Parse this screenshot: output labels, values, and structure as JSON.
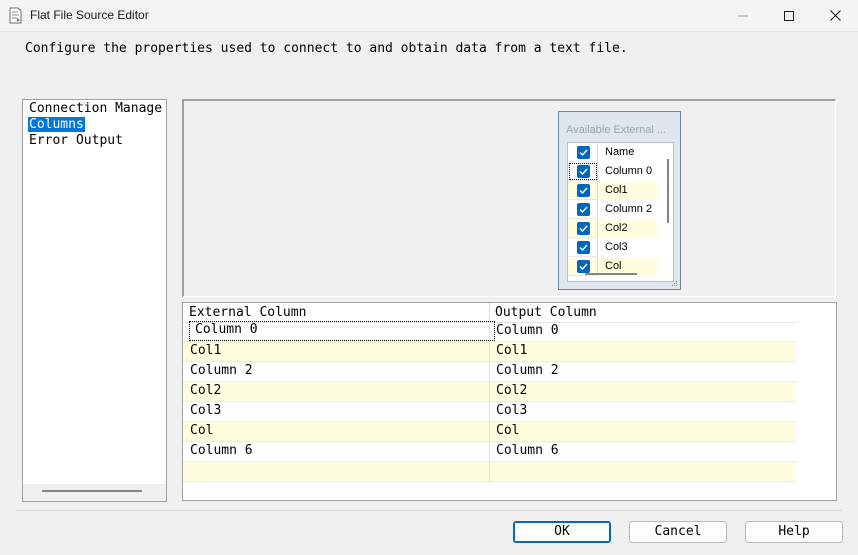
{
  "window": {
    "title": "Flat File Source Editor"
  },
  "description": "Configure the properties used to connect to and obtain data from a text file.",
  "nav": {
    "items": [
      {
        "label": "Connection Manage",
        "selected": false
      },
      {
        "label": "Columns",
        "selected": true
      },
      {
        "label": "Error Output",
        "selected": false
      }
    ]
  },
  "external_columns": {
    "title": "Available External ...",
    "items": [
      {
        "label": "Name",
        "checked": true
      },
      {
        "label": "Column 0",
        "checked": true
      },
      {
        "label": "Col1",
        "checked": true
      },
      {
        "label": "Column 2",
        "checked": true
      },
      {
        "label": "Col2",
        "checked": true
      },
      {
        "label": "Col3",
        "checked": true
      },
      {
        "label": "Col",
        "checked": true
      }
    ]
  },
  "grid": {
    "headers": [
      "External Column",
      "Output Column"
    ],
    "rows": [
      [
        "Column 0",
        "Column 0"
      ],
      [
        "Col1",
        "Col1"
      ],
      [
        "Column 2",
        "Column 2"
      ],
      [
        "Col2",
        "Col2"
      ],
      [
        "Col3",
        "Col3"
      ],
      [
        "Col",
        "Col"
      ],
      [
        "Column 6",
        "Column 6"
      ],
      [
        "",
        ""
      ]
    ]
  },
  "buttons": {
    "ok": "OK",
    "cancel": "Cancel",
    "help": "Help"
  },
  "colors": {
    "selection": "#0078d7",
    "checkbox": "#0067c0",
    "alt_row": "#ffffe0",
    "accent_border": "#0067c0"
  }
}
